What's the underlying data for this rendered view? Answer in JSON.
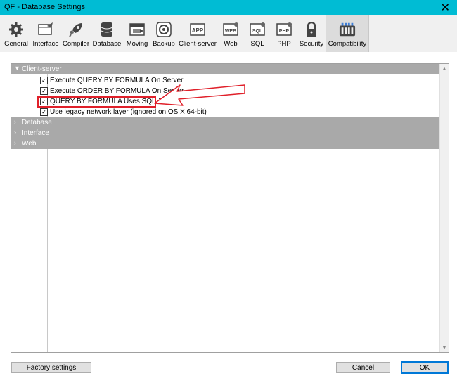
{
  "window": {
    "title": "QF - Database Settings",
    "close_glyph": "✕"
  },
  "toolbar": {
    "items": [
      {
        "label": "General",
        "icon": "gear-icon"
      },
      {
        "label": "Interface",
        "icon": "interface-icon"
      },
      {
        "label": "Compiler",
        "icon": "rocket-icon"
      },
      {
        "label": "Database",
        "icon": "database-icon"
      },
      {
        "label": "Moving",
        "icon": "moving-icon"
      },
      {
        "label": "Backup",
        "icon": "backup-icon"
      },
      {
        "label": "Client-server",
        "icon": "app-icon",
        "badge": "APP"
      },
      {
        "label": "Web",
        "icon": "web-icon",
        "badge": "WEB"
      },
      {
        "label": "SQL",
        "icon": "sql-icon",
        "badge": "SQL"
      },
      {
        "label": "PHP",
        "icon": "php-icon",
        "badge": "PHP"
      },
      {
        "label": "Security",
        "icon": "lock-icon"
      },
      {
        "label": "Compatibility",
        "icon": "compatibility-icon",
        "active": true
      }
    ]
  },
  "groups": [
    {
      "label": "Client-server",
      "expanded": true,
      "chevron": "▼"
    },
    {
      "label": "Database",
      "expanded": false,
      "chevron": "›"
    },
    {
      "label": "Interface",
      "expanded": false,
      "chevron": "›"
    },
    {
      "label": "Web",
      "expanded": false,
      "chevron": "›"
    }
  ],
  "options": [
    {
      "label": "Execute QUERY BY FORMULA On Server",
      "checked": true
    },
    {
      "label": "Execute ORDER BY FORMULA On Server",
      "checked": true
    },
    {
      "label": "QUERY BY FORMULA Uses SQL Joins",
      "checked": true,
      "highlighted": true
    },
    {
      "label": "Use legacy network layer (ignored on OS X 64-bit)",
      "checked": true
    }
  ],
  "check_glyph": "✓",
  "buttons": {
    "factory": "Factory settings",
    "cancel": "Cancel",
    "ok": "OK"
  },
  "colors": {
    "titlebar": "#00bcd4",
    "highlight": "#e0202a",
    "group_header": "#a9a9a9",
    "ok_border": "#0078d7"
  }
}
